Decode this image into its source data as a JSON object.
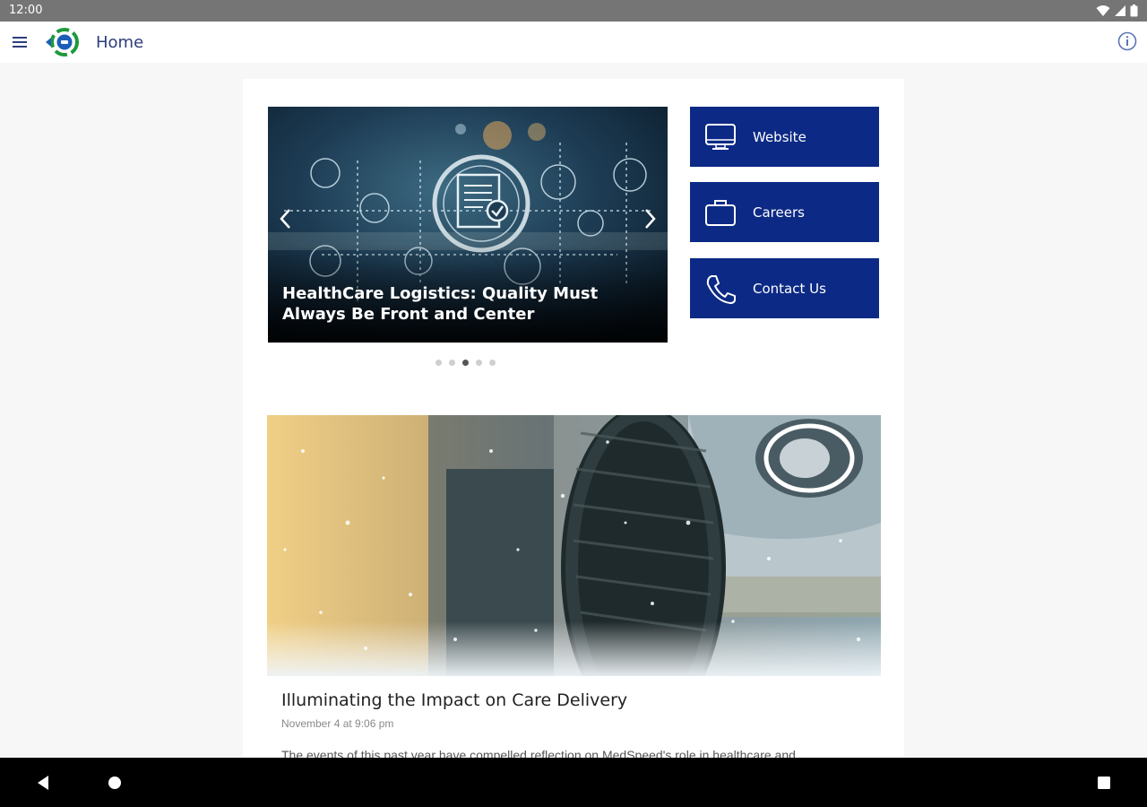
{
  "status_bar": {
    "time": "12:00"
  },
  "app_bar": {
    "title": "Home"
  },
  "carousel": {
    "slide_title": "HealthCare Logistics: Quality Must Always Be Front and Center",
    "slide_count": 5,
    "active_slide": 3
  },
  "quick_links": [
    {
      "label": "Website",
      "icon": "monitor-icon"
    },
    {
      "label": "Careers",
      "icon": "briefcase-icon"
    },
    {
      "label": "Contact Us",
      "icon": "phone-icon"
    }
  ],
  "article": {
    "title": "Illuminating the Impact on Care Delivery",
    "date": "November 4 at 9:06 pm",
    "snippet": "The events of this past year have compelled reflection on MedSpeed's role in healthcare and"
  },
  "colors": {
    "status_bar": "#757575",
    "brand_navy": "#0c2a85",
    "title_text": "#2c3e7a",
    "logo_green": "#1e9a3a",
    "logo_blue": "#1c5fb8"
  }
}
